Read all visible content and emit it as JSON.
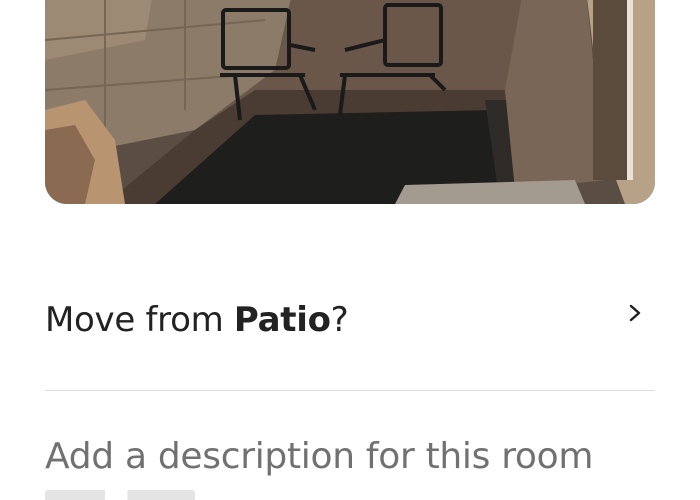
{
  "photo": {
    "alt": "Patio photo",
    "colors": {
      "wall": "#8c7b68",
      "wall_dark": "#5e5147",
      "gravel": "#6b564a",
      "rug": "#1e1e1c",
      "right_wall": "#b8a287",
      "door": "#5a4b3d"
    }
  },
  "move_row": {
    "prefix": "Move from ",
    "room": "Patio",
    "suffix": "?",
    "chevron_icon": "chevron-right-icon"
  },
  "description": {
    "placeholder": "Add a description for this room"
  },
  "colors": {
    "primary_text": "#222222",
    "secondary_text": "#717171",
    "divider": "#dddddd"
  }
}
